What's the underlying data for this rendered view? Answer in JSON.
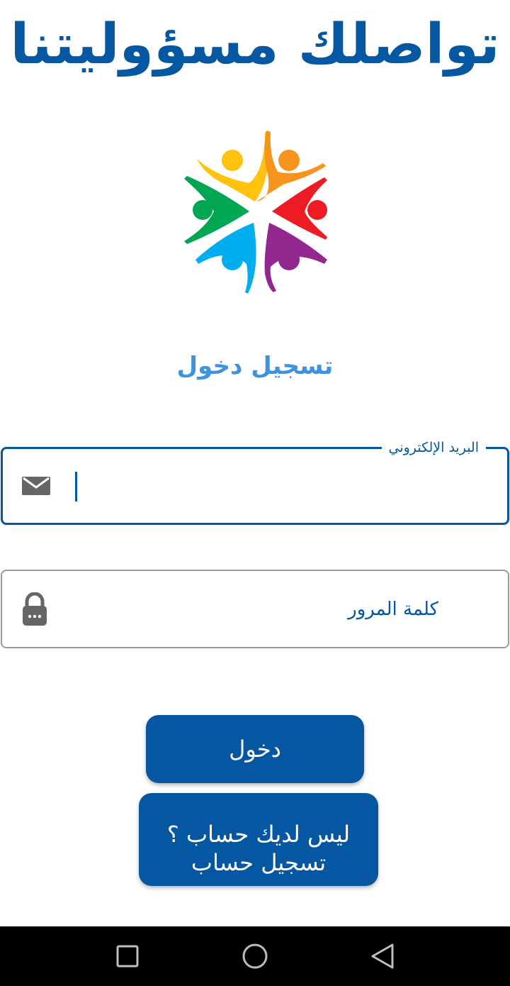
{
  "app": {
    "title": "تواصلك مسؤوليتنا"
  },
  "login": {
    "title": "تسجيل دخول"
  },
  "email_field": {
    "label": "البريد الإلكتروني",
    "value": "",
    "icon": "mail-icon"
  },
  "password_field": {
    "placeholder": "كلمة المرور",
    "icon": "lock-icon"
  },
  "buttons": {
    "login_label": "دخول",
    "register_line1": "ليس لديك حساب ؟",
    "register_line2": "تسجيل حساب"
  },
  "colors": {
    "primary": "#0457a0",
    "title_accent": "#3f92dc",
    "icon_gray": "#666666",
    "logo_yellow": "#ffc20e",
    "logo_orange": "#f7941d",
    "logo_red": "#ed1c24",
    "logo_purple": "#92278f",
    "logo_blue": "#00aeef",
    "logo_green": "#00a651"
  },
  "nav": {
    "recent_icon": "square-icon",
    "home_icon": "circle-icon",
    "back_icon": "triangle-back-icon"
  }
}
